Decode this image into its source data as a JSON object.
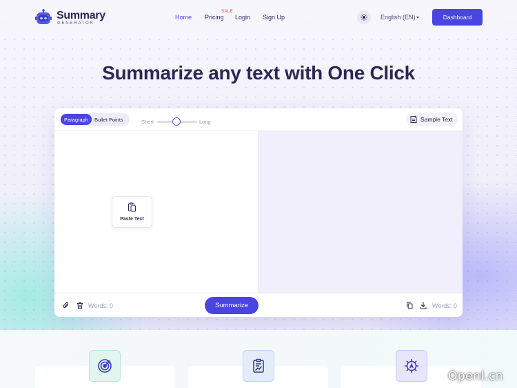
{
  "nav": {
    "logo_title": "Summary",
    "logo_subtitle": "GENERATOR",
    "links": {
      "home": "Home",
      "pricing": "Pricing",
      "pricing_badge": "SALE",
      "login": "Login",
      "signup": "Sign Up"
    },
    "language": "English (EN)",
    "dashboard": "Dashboard"
  },
  "hero": {
    "title": "Summarize any text with One Click"
  },
  "editor": {
    "modes": {
      "paragraph": "Paragraph",
      "bullet_points": "Bullet Points",
      "selected": "Paragraph"
    },
    "length": {
      "short_label": "Short",
      "long_label": "Long",
      "value": 0.48
    },
    "sample_text": "Sample Text",
    "paste_text": "Paste Text",
    "words_input": "Words: 0",
    "summarize": "Summarize",
    "words_output": "Words: 0"
  },
  "icons": {
    "logo": "robot-icon",
    "theme": "sun-icon",
    "sample": "document-import-icon",
    "paste": "clipboard-icon",
    "attach": "paperclip-icon",
    "delete": "trash-icon",
    "copy": "copy-icon",
    "download": "download-icon",
    "features": [
      "target-icon",
      "clipboard-chart-icon",
      "gear-ai-icon"
    ]
  },
  "colors": {
    "accent": "#4a45e0",
    "heading": "#2a2956",
    "sale": "#e04a4a"
  },
  "watermark": "OpenI.cn"
}
